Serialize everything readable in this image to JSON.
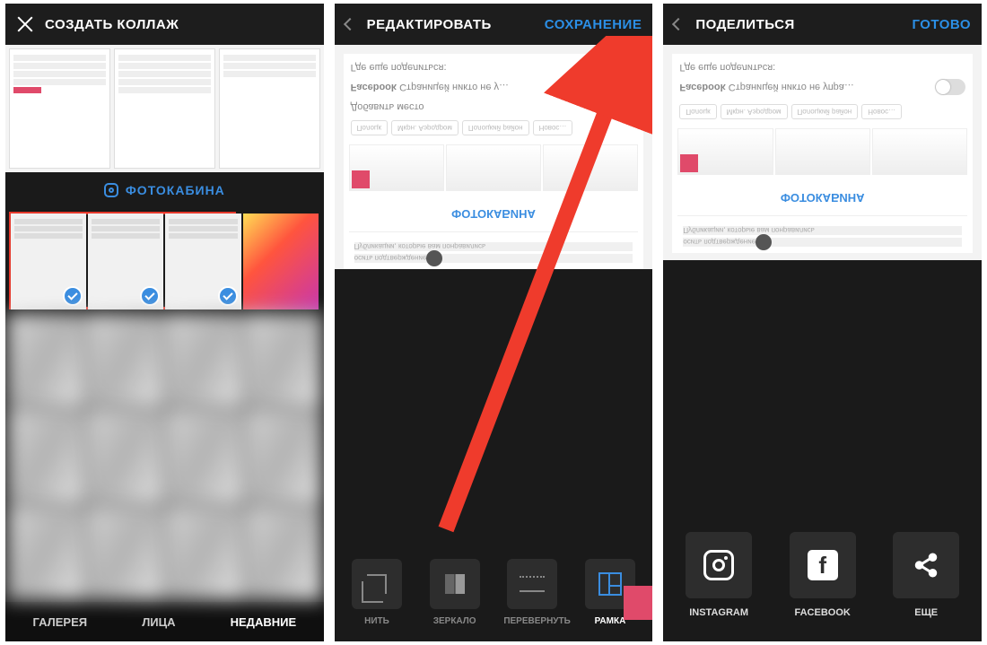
{
  "s1": {
    "title": "СОЗДАТЬ КОЛЛАЖ",
    "photobooth": "ФОТОКАБИНА",
    "tabs": {
      "gallery": "ГАЛЕРЕЯ",
      "faces": "ЛИЦА",
      "recent": "НЕДАВНИЕ"
    },
    "selected_tab": "recent"
  },
  "s2": {
    "title": "РЕДАКТИРОВАТЬ",
    "action": "СОХРАНЕНИЕ",
    "preview": {
      "fb_label": "Facebook",
      "fb_sub": "Страницей никто не у…",
      "where_else": "Где еще поделиться:",
      "chips": [
        "Полоцк",
        "Мкрн. Аэродром",
        "Полоцкий район",
        "Новос…"
      ],
      "add_place": "Добавить место",
      "photobooth": "ФОТОКАБИНА",
      "confirm": "осить подтверждение",
      "liked": "Публикации, которые вам понравились"
    },
    "tools": {
      "crop": "НИТЬ",
      "mirror": "ЗЕРКАЛО",
      "flip": "ПЕРЕВЕРНУТЬ",
      "frame": "РАМКА"
    }
  },
  "s3": {
    "title": "ПОДЕЛИТЬСЯ",
    "action": "ГОТОВО",
    "preview": {
      "fb_label": "Facebook",
      "fb_sub": "Страницей никто не упра…",
      "where_else": "Где еще поделиться:",
      "chips": [
        "Полоцк",
        "Мкрн. Аэродром",
        "Полоцкий район",
        "Новос…"
      ],
      "photobooth": "ФОТОКАБИНА",
      "confirm": "осить подтверждение",
      "liked": "Публикации, которые вам понравились"
    },
    "share": {
      "instagram": "INSTAGRAM",
      "facebook": "FACEBOOK",
      "more": "ЕЩЕ"
    }
  }
}
